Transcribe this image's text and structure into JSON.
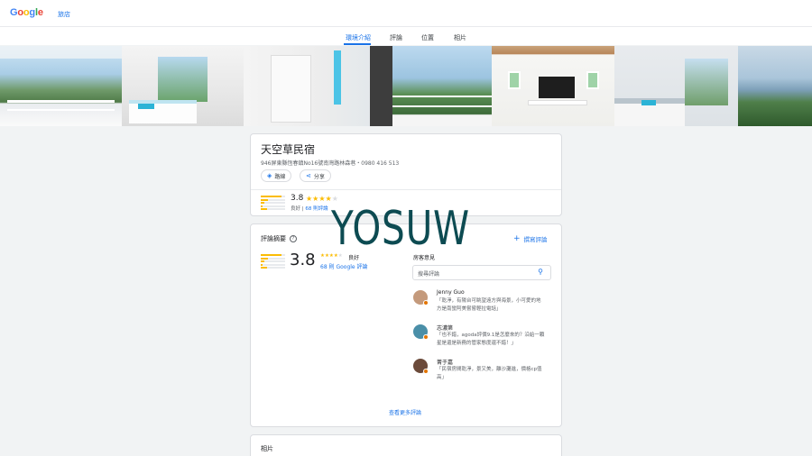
{
  "header": {
    "logo_letters": [
      "G",
      "o",
      "o",
      "g",
      "l",
      "e"
    ],
    "logo_colors": [
      "#4285f4",
      "#ea4335",
      "#fbbc04",
      "#4285f4",
      "#34a853",
      "#ea4335"
    ],
    "nav_link": "旅店"
  },
  "tabs": [
    "環境介紹",
    "評論",
    "位置",
    "相片"
  ],
  "active_tab": "環境介紹",
  "colors": {
    "accent": "#1a73e8",
    "star": "#fbbc04",
    "watermark": "#0d4b52"
  },
  "hotel": {
    "name": "天空草民宿",
    "address": "946屏東縣恆春鎮No16號南灣路林森巷・0980 416 513",
    "actions": [
      {
        "label": "路線",
        "icon": "directions-icon"
      },
      {
        "label": "分享",
        "icon": "share-icon"
      }
    ],
    "rating": "3.8",
    "rating_word": "良好",
    "stars_filled": 4,
    "review_count_label": "68 則評論",
    "rating_distribution": [
      0.85,
      0.3,
      0.15,
      0.08,
      0.25
    ]
  },
  "reviews_summary": {
    "heading": "評論摘要",
    "help_icon": "help-icon",
    "write_review": "撰寫評論",
    "rating": "3.8",
    "rating_word": "良好",
    "google_reviews": "68 則 Google 評論",
    "rating_distribution": [
      0.85,
      0.3,
      0.15,
      0.08,
      0.25
    ],
    "guests_heading": "房客意見",
    "search_placeholder": "搜尋評論",
    "reviews": [
      {
        "name": "Jenny Guo",
        "line1": "「乾淨，有陽台可眺望遠方與海景，小可愛的地",
        "line2": "方是南蠻阿美嘗嘗輕拉電話」",
        "avatar_color": "#c49a7c"
      },
      {
        "name": "志濃第",
        "line1": "「也不錯，agoda評價9.1是怎麼來的？沿給一顆",
        "line2": "星是還是新務的管家態度還不錯！」",
        "avatar_color": "#4a8fa8"
      },
      {
        "name": "菁于嘉",
        "line1": "「民宿房間乾淨，景又美，離沙灘進，價格cp值",
        "line2": "高」",
        "avatar_color": "#6b4a3a"
      }
    ],
    "more_reviews": "查看更多評論"
  },
  "photos_section": {
    "heading": "相片"
  },
  "watermark": "YOSUW"
}
